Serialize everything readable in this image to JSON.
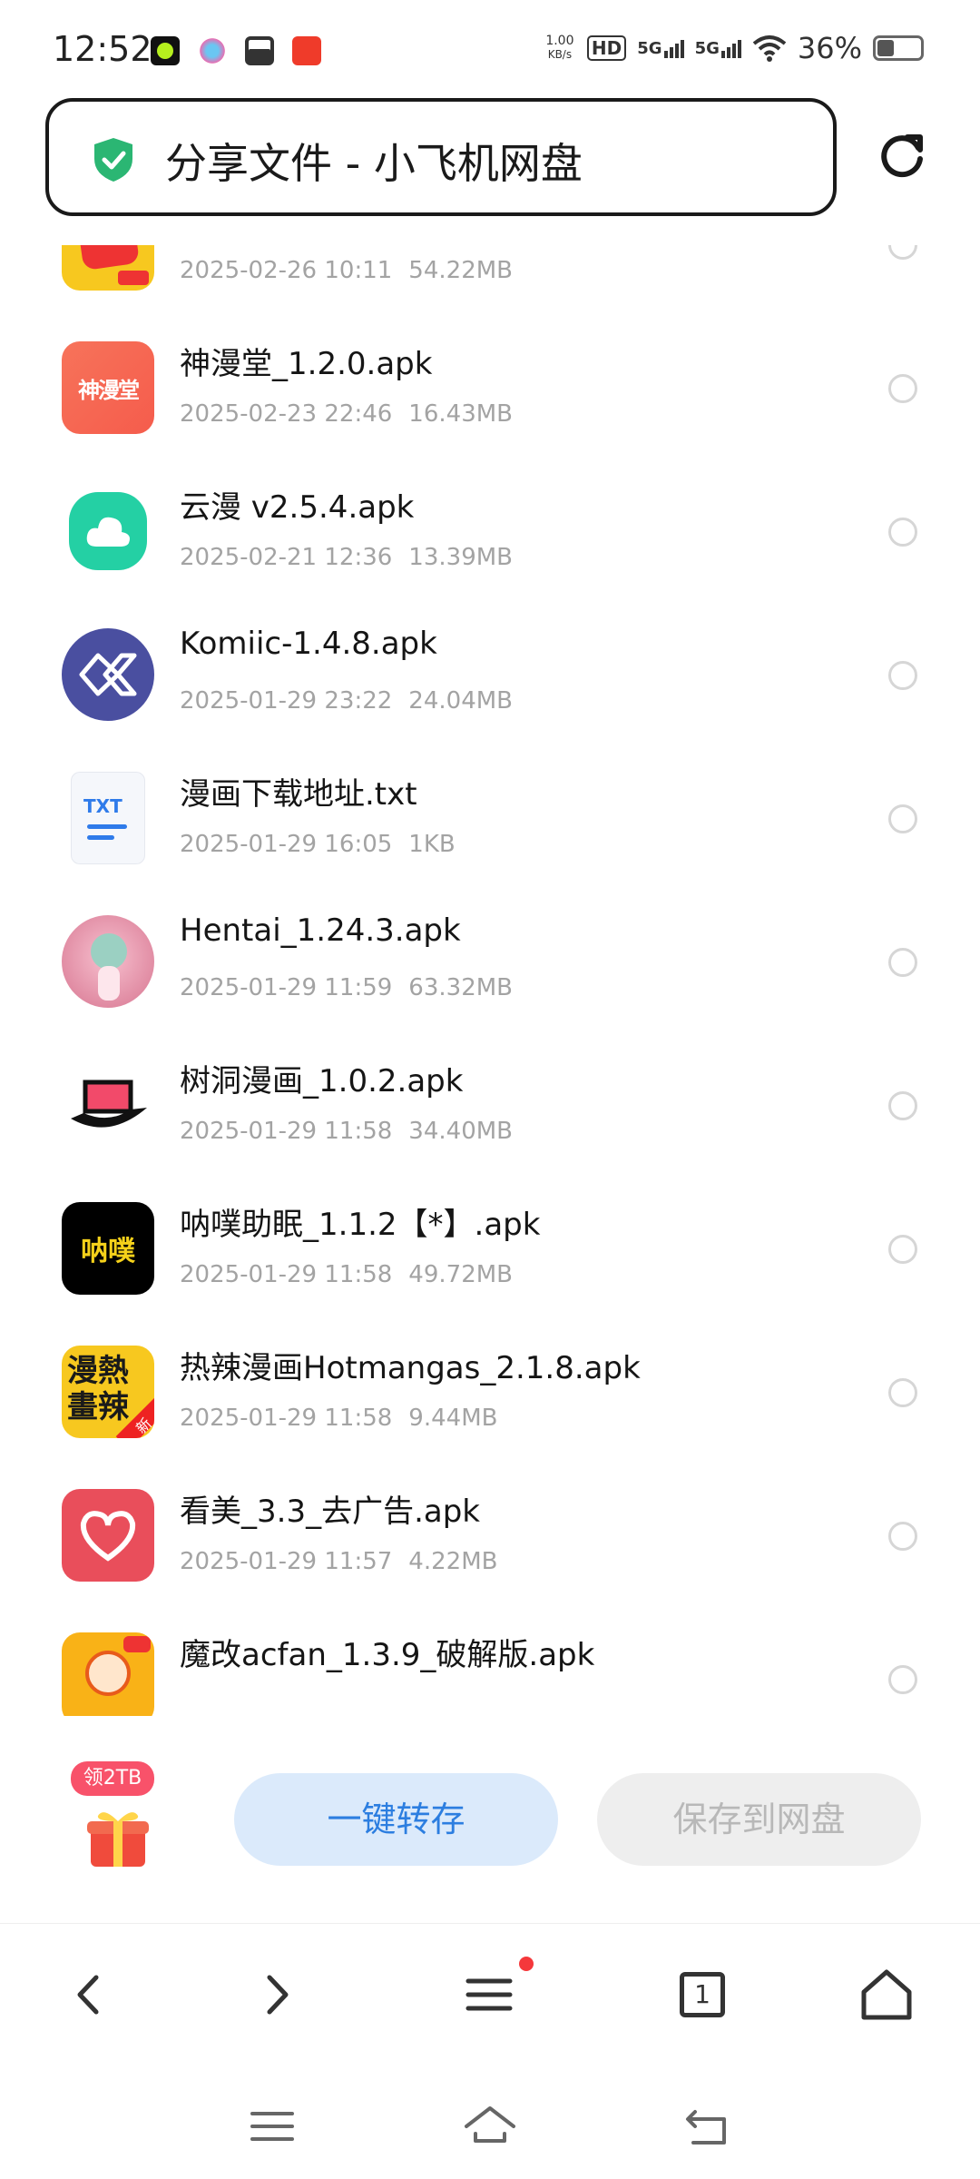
{
  "status_bar": {
    "time": "12:52",
    "speed_value": "1.00",
    "speed_unit": "KB/s",
    "hd_label": "HD",
    "net1": "5G",
    "net2": "5G",
    "battery_text": "36%",
    "battery_level": 0.36
  },
  "address_bar": {
    "title": "分享文件 - 小飞机网盘",
    "shield_icon": "shield-check-icon",
    "reload_icon": "reload-icon"
  },
  "files": [
    {
      "name": "",
      "date": "2025-02-26 10:11",
      "size": "54.22MB",
      "icon": "manga-mini-app-icon",
      "color": "#f7c81f"
    },
    {
      "name": "神漫堂_1.2.0.apk",
      "date": "2025-02-23 22:46",
      "size": "16.43MB",
      "icon": "shenmantang-app-icon",
      "color": "#f55c4c"
    },
    {
      "name": "云漫 v2.5.4.apk",
      "date": "2025-02-21 12:36",
      "size": "13.39MB",
      "icon": "cloud-app-icon",
      "color": "#24d0a4"
    },
    {
      "name": "Komiic-1.4.8.apk",
      "date": "2025-01-29 23:22",
      "size": "24.04MB",
      "icon": "komiic-app-icon",
      "color": "#4a4fa0"
    },
    {
      "name": "漫画下载地址.txt",
      "date": "2025-01-29 16:05",
      "size": "1KB",
      "icon": "txt-file-icon",
      "color": "#2f7bea"
    },
    {
      "name": "Hentai_1.24.3.apk",
      "date": "2025-01-29 11:59",
      "size": "63.32MB",
      "icon": "anime-character-app-icon",
      "color": "#e8a0b4"
    },
    {
      "name": "树洞漫画_1.0.2.apk",
      "date": "2025-01-29 11:58",
      "size": "34.40MB",
      "icon": "treehole-hat-app-icon",
      "color": "#f24a6a"
    },
    {
      "name": "呐噗助眠_1.1.2【*】.apk",
      "date": "2025-01-29 11:58",
      "size": "49.72MB",
      "icon": "napu-app-icon",
      "color": "#000000"
    },
    {
      "name": "热辣漫画Hotmangas_2.1.8.apk",
      "date": "2025-01-29 11:58",
      "size": "9.44MB",
      "icon": "hotmangas-app-icon",
      "color": "#f7c81f"
    },
    {
      "name": "看美_3.3_去广告.apk",
      "date": "2025-01-29 11:57",
      "size": "4.22MB",
      "icon": "kanmei-heart-app-icon",
      "color": "#e94e5b"
    },
    {
      "name": "魔改acfan_1.3.9_破解版.apk",
      "date": "",
      "size": "",
      "icon": "acfan-app-icon",
      "color": "#f9b217"
    }
  ],
  "actions": {
    "gift_badge": "领2TB",
    "gift_icon": "gift-box-icon",
    "one_click": "一键转存",
    "save_to_drive": "保存到网盘"
  },
  "icon_glyphs": {
    "shenmantang": "神漫堂",
    "txt": "TXT",
    "napu": "呐噗",
    "hot1": "漫熱",
    "hot2": "畫辣",
    "hot_tag": "新"
  },
  "browser_nav": [
    "back-icon",
    "forward-icon",
    "menu-icon",
    "tabs-icon",
    "home-icon"
  ],
  "tab_count": "1",
  "system_nav": [
    "recents-icon",
    "home-icon",
    "back-icon"
  ]
}
